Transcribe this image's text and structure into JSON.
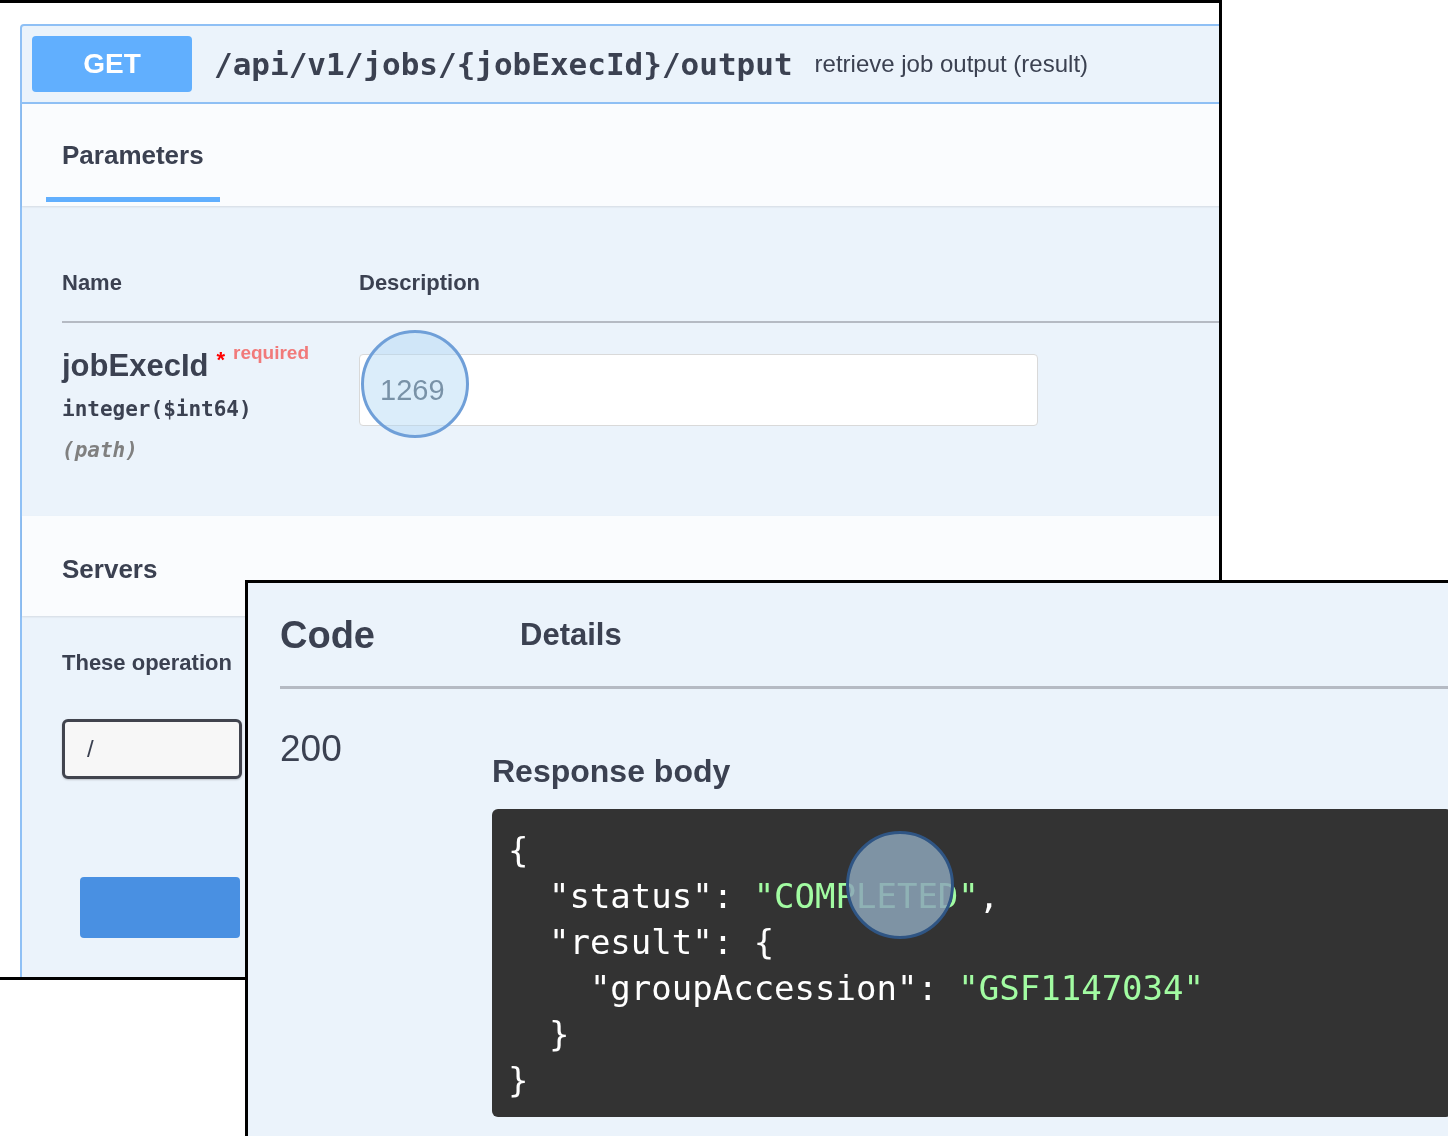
{
  "operation": {
    "method": "GET",
    "path": "/api/v1/jobs/{jobExecId}/output",
    "summary": "retrieve job output (result)"
  },
  "tabs": [
    {
      "label": "Parameters",
      "selected": true
    }
  ],
  "parameters": {
    "columns": [
      "Name",
      "Description"
    ],
    "rows": [
      {
        "name": "jobExecId",
        "required": true,
        "required_mark": "*",
        "required_label": "required",
        "type": "integer($int64)",
        "location": "(path)",
        "value": "1269",
        "clicked": true
      }
    ]
  },
  "servers": {
    "title": "Servers",
    "note": "These operation",
    "selected_server": "/"
  },
  "responses": {
    "columns": [
      "Code",
      "Details"
    ],
    "code": "200",
    "body_title": "Response body",
    "body_lines": [
      [
        {
          "kind": "plain",
          "text": "{"
        }
      ],
      [
        {
          "kind": "plain",
          "text": "  \"status\": "
        },
        {
          "kind": "string",
          "text": "\"COMPLETED\""
        },
        {
          "kind": "plain",
          "text": ","
        }
      ],
      [
        {
          "kind": "plain",
          "text": "  \"result\": {"
        }
      ],
      [
        {
          "kind": "plain",
          "text": "    \"groupAccession\": "
        },
        {
          "kind": "string",
          "text": "\"GSF1147034\""
        }
      ],
      [
        {
          "kind": "plain",
          "text": "  }"
        }
      ],
      [
        {
          "kind": "plain",
          "text": "}"
        }
      ]
    ]
  }
}
